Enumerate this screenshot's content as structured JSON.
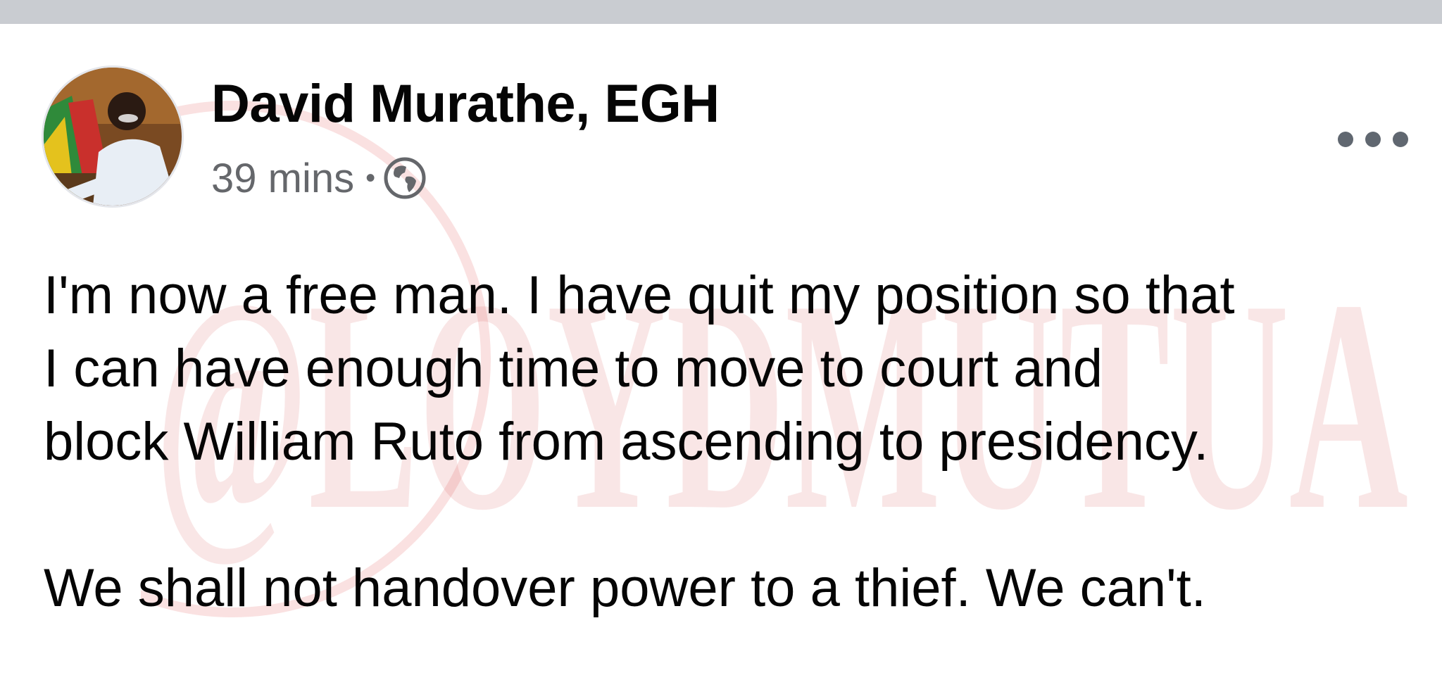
{
  "post": {
    "author_name": "David Murathe, EGH",
    "timestamp": "39 mins",
    "separator": "•",
    "privacy_icon": "globe-icon",
    "more_icon": "more-options-icon",
    "body_lines": [
      "I'm now a free man. I have quit my position so that",
      "I can have enough time to move to court and",
      "block William Ruto from ascending to presidency."
    ],
    "body_second_paragraph": "We shall not handover power to a thief. We can't."
  },
  "watermark": {
    "text": "@LOYDMUTUA"
  },
  "colors": {
    "top_bar": "#c9ccd1",
    "text_primary": "#050505",
    "text_secondary": "#65676b",
    "watermark_red": "#d44a4a"
  }
}
